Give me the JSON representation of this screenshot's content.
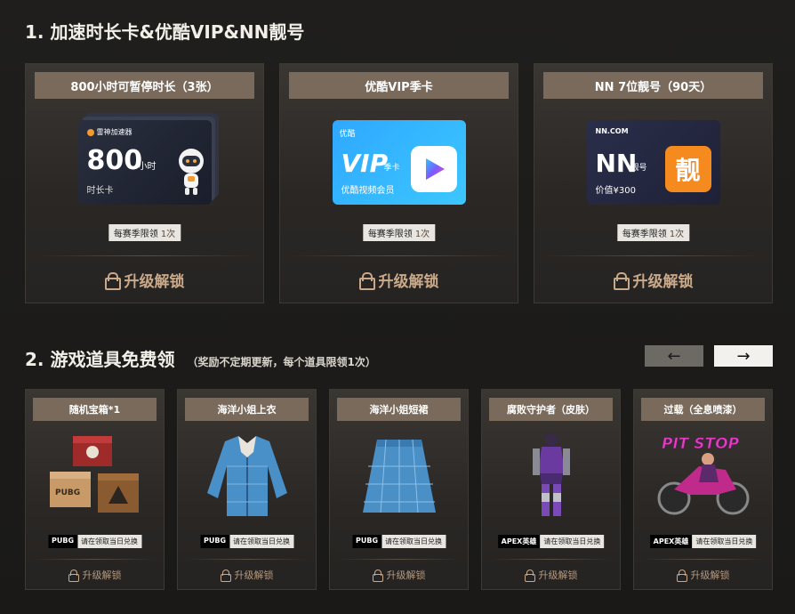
{
  "section1": {
    "title": "1. 加速时长卡&优酷VIP&NN靓号",
    "cards": [
      {
        "title": "800小时可暂停时长（3张）",
        "limit_label": "每赛季限领",
        "limit_count": "1次",
        "unlock": "升级解锁",
        "visual": {
          "brand": "雷神加速器",
          "value": "800",
          "unit": "小时",
          "name": "时长卡"
        }
      },
      {
        "title": "优酷VIP季卡",
        "limit_label": "每赛季限领",
        "limit_count": "1次",
        "unlock": "升级解锁",
        "visual": {
          "brand": "优酷",
          "value": "VIP",
          "unit": "季卡",
          "name": "优酷视频会员"
        }
      },
      {
        "title": "NN 7位靓号（90天）",
        "limit_label": "每赛季限领",
        "limit_count": "1次",
        "unlock": "升级解锁",
        "visual": {
          "brand": "NN.COM",
          "value": "NN",
          "unit": "靓号",
          "name": "价值¥300",
          "badge": "靓"
        }
      }
    ]
  },
  "section2": {
    "title": "2. 游戏道具免费领",
    "subtitle": "（奖励不定期更新，每个道具限领1次）",
    "prev": "←",
    "next": "→",
    "items": [
      {
        "title": "随机宝箱*1",
        "game": "PUBG",
        "note": "请在领取当日兑换",
        "unlock": "升级解锁",
        "art": "PUBG"
      },
      {
        "title": "海洋小姐上衣",
        "game": "PUBG",
        "note": "请在领取当日兑换",
        "unlock": "升级解锁"
      },
      {
        "title": "海洋小姐短裙",
        "game": "PUBG",
        "note": "请在领取当日兑换",
        "unlock": "升级解锁"
      },
      {
        "title": "腐败守护者（皮肤）",
        "game": "APEX英雄",
        "note": "请在领取当日兑换",
        "unlock": "升级解锁"
      },
      {
        "title": "过载（全息喷漆）",
        "game": "APEX英雄",
        "note": "请在领取当日兑换",
        "unlock": "升级解锁",
        "art": "PIT STOP"
      }
    ]
  },
  "colors": {
    "accent": "#7a6a5b",
    "unlock": "#c9a98a",
    "background": "#1c1b1a"
  }
}
